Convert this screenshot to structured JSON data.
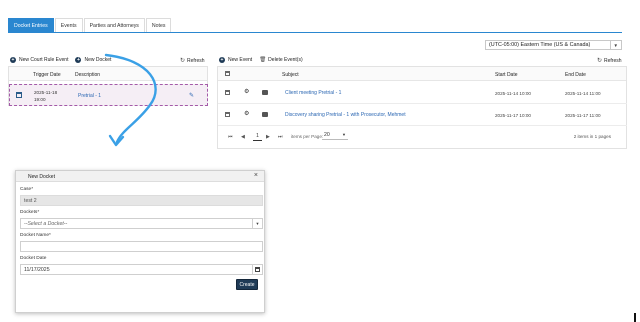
{
  "tabs": [
    {
      "label": "Docket Entries",
      "active": true
    },
    {
      "label": "Events",
      "active": false
    },
    {
      "label": "Parties and Attorneys",
      "active": false
    },
    {
      "label": "Notes",
      "active": false
    }
  ],
  "timezone": {
    "value": "(UTC-05:00) Eastern Time (US & Canada)"
  },
  "left_toolbar": {
    "new_court_rule_event": "New Court Rule Event",
    "new_docket": "New Docket",
    "refresh": "Refresh"
  },
  "left_grid": {
    "columns": [
      "Trigger Date",
      "Description"
    ],
    "rows": [
      {
        "trigger_date": "2025-11-18",
        "trigger_time": "19:00",
        "description": "Pretrial - 1"
      }
    ]
  },
  "right_toolbar": {
    "new_event": "New Event",
    "delete_events": "Delete Event(s)",
    "refresh": "Refresh"
  },
  "right_grid": {
    "columns": [
      "Subject",
      "Start Date",
      "End Date"
    ],
    "rows": [
      {
        "subject": "Client meeting Pretrial - 1",
        "start": "2025-11-14 10:00",
        "end": "2025-11-14 11:00"
      },
      {
        "subject": "Discovery sharing Pretrial - 1 with Prosecutor, Mehmet",
        "start": "2025-11-17 10:00",
        "end": "2025-11-17 11:00"
      }
    ],
    "pager": {
      "current_page": "1",
      "per_page_label": "items per Page:",
      "per_page": "20",
      "items_info": "2 items in 1 pages"
    }
  },
  "modal": {
    "title": "New Docket",
    "case_label": "Case*",
    "case_value": "test 2",
    "dockets_label": "Dockets*",
    "dockets_placeholder": "--Select a Docket--",
    "docket_name_label": "Docket Name*",
    "docket_name_value": "",
    "docket_date_label": "Docket Date",
    "docket_date_value": "11/17/2025",
    "create_label": "Create"
  },
  "colors": {
    "accent": "#2a87d0",
    "primary_button": "#1f3b57",
    "link": "#2a66b2",
    "selected_row": "#f5eef5",
    "selection_border": "#a45aa8",
    "arrow": "#3aa0e6"
  },
  "icons": [
    "plus-circle-icon",
    "refresh-icon",
    "trash-icon",
    "calendar-icon",
    "pencil-icon",
    "gear-icon",
    "document-icon",
    "close-icon",
    "chevron-down-icon"
  ]
}
